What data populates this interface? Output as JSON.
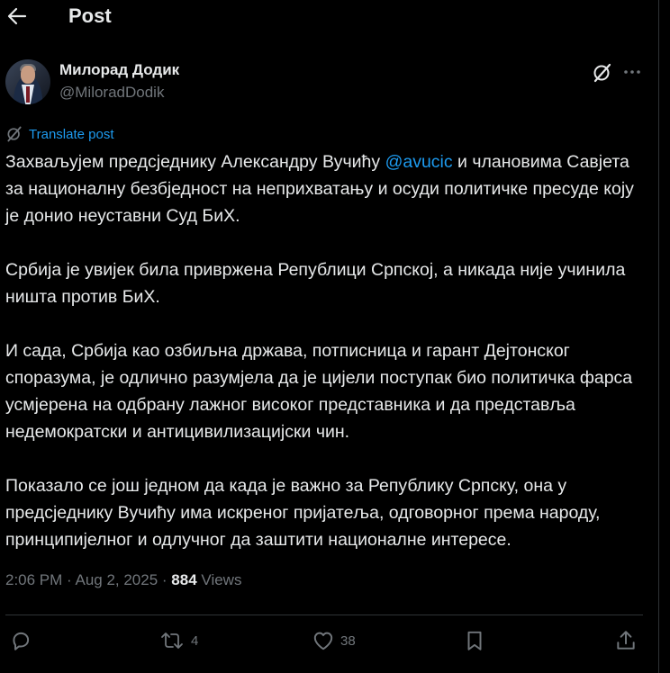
{
  "header": {
    "title": "Post",
    "back_icon": "arrow-left-icon"
  },
  "author": {
    "name": "Милорад Додик",
    "handle": "@MiloradDodik"
  },
  "translate_label": "Translate post",
  "body": {
    "p1_before": "Захваљујем предсједнику Александру Вучићу ",
    "mention": "@avucic",
    "p1_after": " и члановима Савјета за националну безбједност на неприхватању и осуди политичке пресуде коју је донио неуставни Суд БиХ.",
    "p2": "Србија је увијек била привржена Републици Српској, а никада није учинила ништа против БиХ.",
    "p3": "И сада, Србија као озбиљна држава, потписница и гарант Дејтонског споразума, је одлично разумјела да је цијели поступак био политичка фарса усмјерена на одбрану лажног високог представника и да представља недемократски и антицивилизацијски чин.",
    "p4": "Показало се још једном да када је важно за Републику Српску, она у предсједнику Вучићу има искреног пријатеља, одговорног према народу, принципијелног и одлучног да заштити националне интересе."
  },
  "meta": {
    "time": "2:06 PM",
    "separator": " · ",
    "date": "Aug 2, 2025",
    "views_count": "884",
    "views_label": "Views"
  },
  "actions": {
    "replies": "",
    "reposts": "4",
    "likes": "38"
  },
  "colors": {
    "background": "#000000",
    "text": "#e7e9ea",
    "muted": "#71767b",
    "accent": "#1d9bf0",
    "divider": "#2f3336"
  }
}
